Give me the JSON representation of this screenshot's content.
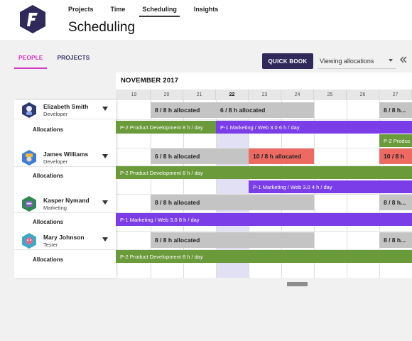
{
  "nav": {
    "items": [
      "Projects",
      "Time",
      "Scheduling",
      "Insights"
    ],
    "active": "Scheduling"
  },
  "page_title": "Scheduling",
  "tabs": {
    "people": "PEOPLE",
    "projects": "PROJECTS",
    "active": "PEOPLE"
  },
  "toolbar": {
    "quick_book": "QUICK BOOK",
    "view_select": "Viewing allocations"
  },
  "calendar": {
    "month": "NOVEMBER 2017",
    "days": [
      "19",
      "20",
      "21",
      "22",
      "23",
      "24",
      "25",
      "26",
      "27"
    ],
    "today": "22"
  },
  "people": [
    {
      "name": "Elizabeth Smith",
      "role": "Developer",
      "allocations_label": "Allocations",
      "capacity": [
        "8 / 8 h allocated",
        "6 / 8 h allocated",
        "8 / 8 h..."
      ],
      "bars": [
        "P-2 Product Development 8 h / day",
        "P-1 Marketing / Web 3.0 6 h / day",
        "P-2 Produc"
      ]
    },
    {
      "name": "James Williams",
      "role": "Developer",
      "allocations_label": "Allocations",
      "capacity": [
        "6 / 8 h allocated",
        "10 / 8 h allocated",
        "10 / 8 h"
      ],
      "bars": [
        "P-2 Product Development 6 h / day",
        "P-1 Marketing / Web 3.0 4 h / day"
      ]
    },
    {
      "name": "Kasper Nymand",
      "role": "Marketing",
      "allocations_label": "Allocations",
      "capacity": [
        "8 / 8 h allocated",
        "8 / 8 h..."
      ],
      "bars": [
        "P-1 Marketing / Web 3.0 8 h / day"
      ]
    },
    {
      "name": "Mary Johnson",
      "role": "Tester",
      "allocations_label": "Allocations",
      "capacity": [
        "8 / 8 h allocated",
        "8 / 8 h..."
      ],
      "bars": [
        "P-2 Product Development 8 h / day"
      ]
    }
  ],
  "colors": {
    "brand": "#2f2a5a",
    "accent": "#d63bc3",
    "allocated": "#c4c4c4",
    "overallocated": "#ec6a62",
    "product_dev": "#6a9a3a",
    "marketing": "#7b3de8",
    "today": "#e2e0f5"
  }
}
